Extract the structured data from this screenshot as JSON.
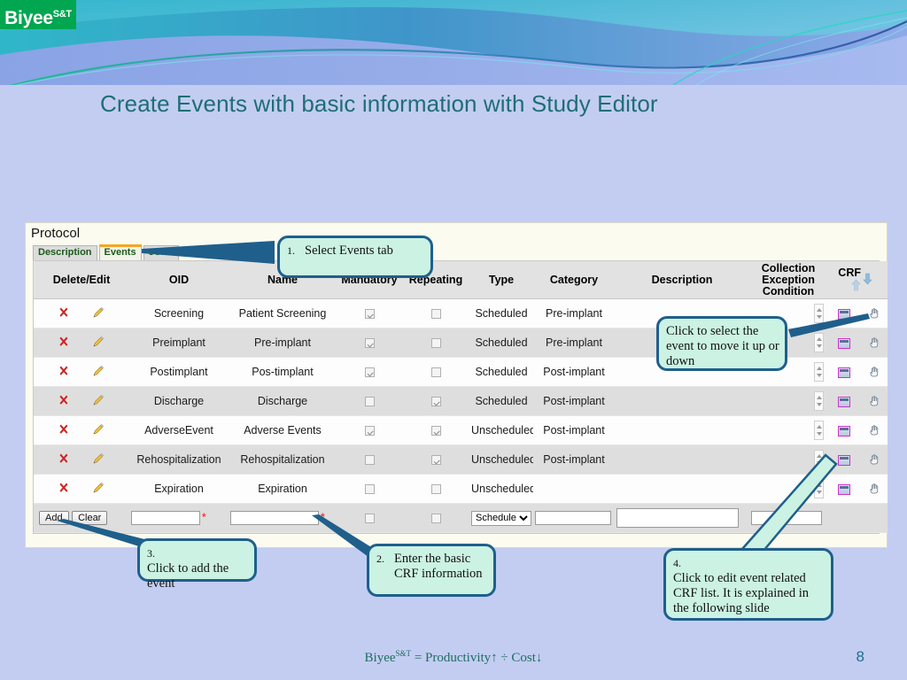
{
  "brand": {
    "logo_text": "Biyee",
    "logo_sup": "S&T",
    "accent_green": "#00a650",
    "title_color": "#1f6e74"
  },
  "slide": {
    "title": "Create Events with basic information with Study Editor",
    "page_number": "8",
    "footer": {
      "prefix": "Biyee",
      "sup": "S&T",
      "equation": "= Productivity↑ ÷ Cost↓"
    }
  },
  "app": {
    "panel_label": "Protocol",
    "tabs": [
      {
        "label": "Description",
        "active": false
      },
      {
        "label": "Events",
        "active": true
      },
      {
        "label": "eCRF",
        "active": false
      }
    ],
    "columns": [
      "Delete/Edit",
      "OID",
      "Name",
      "Mandatory",
      "Repeating",
      "Type",
      "Category",
      "Description",
      "Collection Exception Condition",
      "CRF"
    ],
    "sort_arrows": {
      "up": "up-arrow-icon",
      "down": "down-arrow-icon"
    },
    "rows": [
      {
        "oid": "Screening",
        "name": "Patient Screening",
        "mandatory": true,
        "repeating": false,
        "type": "Scheduled",
        "category": "Pre-implant",
        "description": ""
      },
      {
        "oid": "Preimplant",
        "name": "Pre-implant",
        "mandatory": true,
        "repeating": false,
        "type": "Scheduled",
        "category": "Pre-implant",
        "description": ""
      },
      {
        "oid": "Postimplant",
        "name": "Pos-timplant",
        "mandatory": true,
        "repeating": false,
        "type": "Scheduled",
        "category": "Post-implant",
        "description": ""
      },
      {
        "oid": "Discharge",
        "name": "Discharge",
        "mandatory": false,
        "repeating": true,
        "type": "Scheduled",
        "category": "Post-implant",
        "description": ""
      },
      {
        "oid": "AdverseEvent",
        "name": "Adverse Events",
        "mandatory": true,
        "repeating": true,
        "type": "Unscheduled",
        "category": "Post-implant",
        "description": ""
      },
      {
        "oid": "Rehospitalization",
        "name": "Rehospitalization",
        "mandatory": false,
        "repeating": true,
        "type": "Unscheduled",
        "category": "Post-implant",
        "description": ""
      },
      {
        "oid": "Expiration",
        "name": "Expiration",
        "mandatory": false,
        "repeating": false,
        "type": "Unscheduled",
        "category": "",
        "description": ""
      }
    ],
    "entry_row": {
      "add_label": "Add",
      "clear_label": "Clear",
      "oid_value": "",
      "name_value": "",
      "required_mark": "*",
      "mandatory_checked": false,
      "repeating_checked": false,
      "type_selected": "Scheduled",
      "type_options": [
        "Scheduled",
        "Unscheduled"
      ],
      "category_value": "",
      "description_value": "",
      "condition_value": ""
    },
    "row_icons": {
      "delete": "delete-icon",
      "edit": "edit-pencil-icon",
      "crf": "crf-grid-icon",
      "select": "hand-pointer-icon",
      "spinner": "spinner-icon"
    }
  },
  "callouts": [
    {
      "num": "1.",
      "text": "Select Events tab"
    },
    {
      "num": "",
      "text": "Click to select the event to move it up or down"
    },
    {
      "num": "3.",
      "text": "Click to add the event"
    },
    {
      "num": "2.",
      "text": "Enter the basic CRF information"
    },
    {
      "num": "4.",
      "text": "Click to edit event related CRF list. It is explained in the following slide"
    }
  ]
}
